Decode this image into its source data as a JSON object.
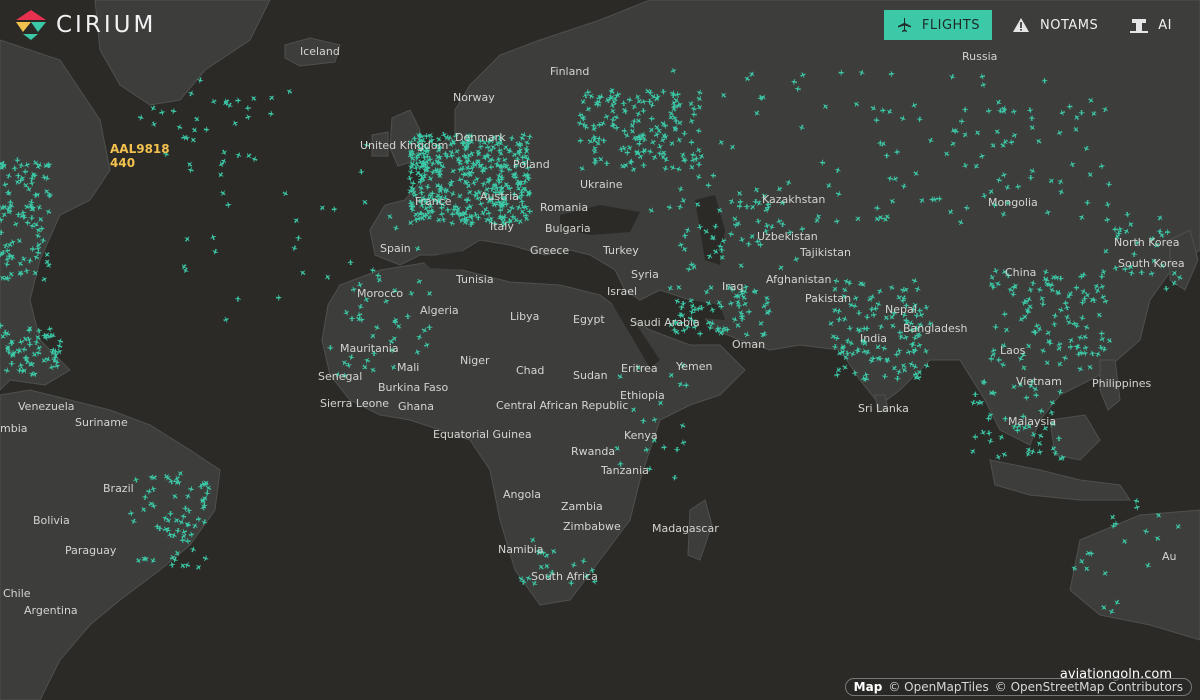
{
  "brand": {
    "name": "CIRIUM"
  },
  "nav": {
    "flights": "FLIGHTS",
    "notams": "NOTAMS",
    "ai": "AI"
  },
  "selected_flight": {
    "callsign": "AAL9818",
    "value": "440"
  },
  "colors": {
    "accent": "#3cc9a7",
    "flight_label": "#f2c14e",
    "ocean": "#2b2a27",
    "land": "#3d3e3c"
  },
  "map_labels": [
    "Iceland",
    "Finland",
    "Russia",
    "Norway",
    "United Kingdom",
    "Denmark",
    "Poland",
    "Ukraine",
    "France",
    "Austria",
    "Romania",
    "Kazakhstan",
    "Mongolia",
    "Spain",
    "Italy",
    "Bulgaria",
    "Greece",
    "Turkey",
    "Uzbekistan",
    "Tajikistan",
    "North Korea",
    "South Korea",
    "Tunisia",
    "Syria",
    "Iraq",
    "Afghanistan",
    "China",
    "Morocco",
    "Algeria",
    "Libya",
    "Egypt",
    "Israel",
    "Saudi Arabia",
    "Pakistan",
    "Nepal",
    "Bangladesh",
    "India",
    "Oman",
    "Mauritania",
    "Mali",
    "Niger",
    "Chad",
    "Sudan",
    "Eritrea",
    "Yemen",
    "Laos",
    "Philippines",
    "Senegal",
    "Burkina Faso",
    "Vietnam",
    "Sierra Leone",
    "Ghana",
    "Central African Republic",
    "Ethiopia",
    "Sri Lanka",
    "Venezuela",
    "Suriname",
    "Malaysia",
    "Equatorial Guinea",
    "Kenya",
    "Rwanda",
    "Tanzania",
    "Brazil",
    "Angola",
    "Zambia",
    "Zimbabwe",
    "Bolivia",
    "Madagascar",
    "Namibia",
    "Paraguay",
    "South Africa",
    "Chile",
    "Argentina",
    "Au",
    "mbia"
  ],
  "attribution": {
    "map": "Map",
    "tiles": "© OpenMapTiles",
    "osm": "© OpenStreetMap Contributors"
  },
  "watermark": "aviationgoln.com"
}
